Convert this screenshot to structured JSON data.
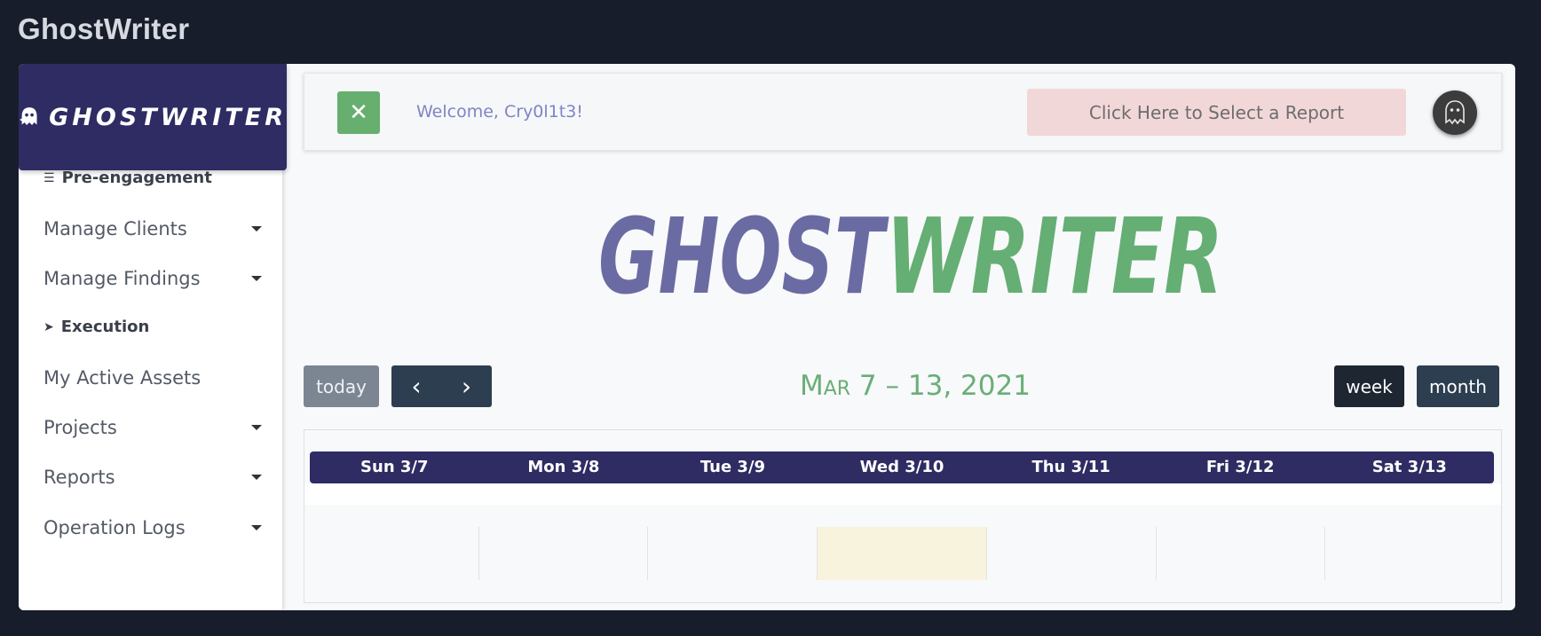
{
  "window": {
    "title": "GhostWriter"
  },
  "sidebar": {
    "brand_text": "GHOSTWRITER",
    "sections": [
      {
        "heading": "Pre-engagement",
        "icon": "list-check-icon",
        "items": [
          {
            "label": "Manage Clients",
            "dropdown": true
          },
          {
            "label": "Manage Findings",
            "dropdown": true
          }
        ]
      },
      {
        "heading": "Execution",
        "icon": "running-person-icon",
        "items": [
          {
            "label": "My Active Assets",
            "dropdown": false
          },
          {
            "label": "Projects",
            "dropdown": true
          },
          {
            "label": "Reports",
            "dropdown": true
          },
          {
            "label": "Operation Logs",
            "dropdown": true
          }
        ]
      }
    ]
  },
  "topbar": {
    "close_icon": "close-x-icon",
    "welcome_text": "Welcome, Cry0l1t3!",
    "report_select_label": "Click Here to Select a Report",
    "avatar_icon": "ghost-avatar-icon"
  },
  "hero": {
    "logo_part1": "GHOST",
    "logo_part2": "WRITER",
    "colors": {
      "part1": "#6b6ba3",
      "part2": "#65ae74"
    }
  },
  "calendar": {
    "today_label": "today",
    "prev_icon": "chevron-left-icon",
    "next_icon": "chevron-right-icon",
    "range_title": "Mar 7 – 13, 2021",
    "view_week_label": "week",
    "view_month_label": "month",
    "active_view": "week",
    "days": [
      "Sun 3/7",
      "Mon 3/8",
      "Tue 3/9",
      "Wed 3/10",
      "Thu 3/11",
      "Fri 3/12",
      "Sat 3/13"
    ],
    "today_column": "Wed 3/10"
  },
  "colors": {
    "page_bg": "#181d2b",
    "brand": "#2e2c63",
    "accent_green": "#67af6f",
    "report_select_bg": "#f2d7d9",
    "today_highlight": "#f8f3dd"
  }
}
